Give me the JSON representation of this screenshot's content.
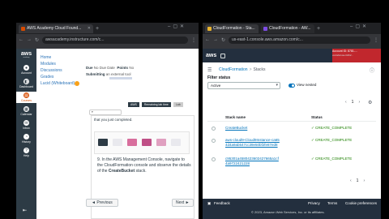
{
  "left_browser": {
    "tabs": [
      {
        "title": "AWS Academy Cloud Found...",
        "color": "#d64b00"
      }
    ],
    "url": "awsacademy.instructure.com/c..."
  },
  "right_browser": {
    "tabs": [
      {
        "title": "CloudFormation - Sta...",
        "color": "#e8b32e"
      },
      {
        "title": "CloudFormation - AW...",
        "color": "#7d4ce4"
      }
    ],
    "url": "us-east-1.console.aws.amazon.com/c..."
  },
  "canvas": {
    "logo": "aws",
    "logo_sub": "academy",
    "nav": [
      {
        "label": "Account",
        "icon": "account-icon"
      },
      {
        "label": "Dashboard",
        "icon": "dashboard-icon"
      },
      {
        "label": "Courses",
        "icon": "courses-icon",
        "active": true
      },
      {
        "label": "Calendar",
        "icon": "calendar-icon"
      },
      {
        "label": "Inbox",
        "icon": "inbox-icon"
      },
      {
        "label": "History",
        "icon": "history-icon"
      },
      {
        "label": "Help",
        "icon": "help-icon"
      }
    ],
    "course_nav": [
      "Home",
      "Modules",
      "Discussions",
      "Grades",
      "Lucid (Whiteboard)"
    ],
    "grades_badge_color": "#f7a11a",
    "meta_due_label": "Due",
    "meta_due_value": "No Due Date",
    "meta_points_label": "Points",
    "meta_points_value": "No",
    "meta_submitting_label": "Submitting",
    "meta_submitting_value": "an external tool",
    "doc_buttons": [
      "AWS",
      "Remaining lab time",
      "Lab"
    ],
    "instruction_text": "that you just completed.",
    "step_prefix": "9.  In the AWS Management Console, navigate to the CloudFormation console and observe the details of the ",
    "step_bold": "CreateBucket",
    "step_suffix": " stack.",
    "prev_label": "◄ Previous",
    "next_label": "Next ►"
  },
  "aws": {
    "logo": "aws",
    "region": "...",
    "account_line1": "Account ID: 8781-...",
    "account_line2": "voclabs/user4462...",
    "breadcrumb": [
      "CloudFormation",
      "Stacks"
    ],
    "filter_label": "Filter status",
    "filter_value": "Active",
    "view_nested": "View nested",
    "page_number": "1",
    "col_name": "Stack name",
    "col_status": "Status",
    "stacks": [
      {
        "name": "CreateBucket",
        "status": "CREATE_COMPLETE"
      },
      {
        "name": "aws-cloud9-Cloud9Instance-ca654d4a9ab547cc39e50bf2fe87ed8",
        "status": "CREATE_COMPLETE"
      },
      {
        "name": "c95301a4580423602427665a1cf4a9722421228",
        "status": "CREATE_COMPLETE"
      }
    ],
    "footer_feedback": "Feedback",
    "footer_privacy": "Privacy",
    "footer_terms": "Terms",
    "footer_cookie": "Cookie preferences",
    "footer_copyright": "© 2023, Amazon Web Services, Inc. or its affiliates."
  }
}
